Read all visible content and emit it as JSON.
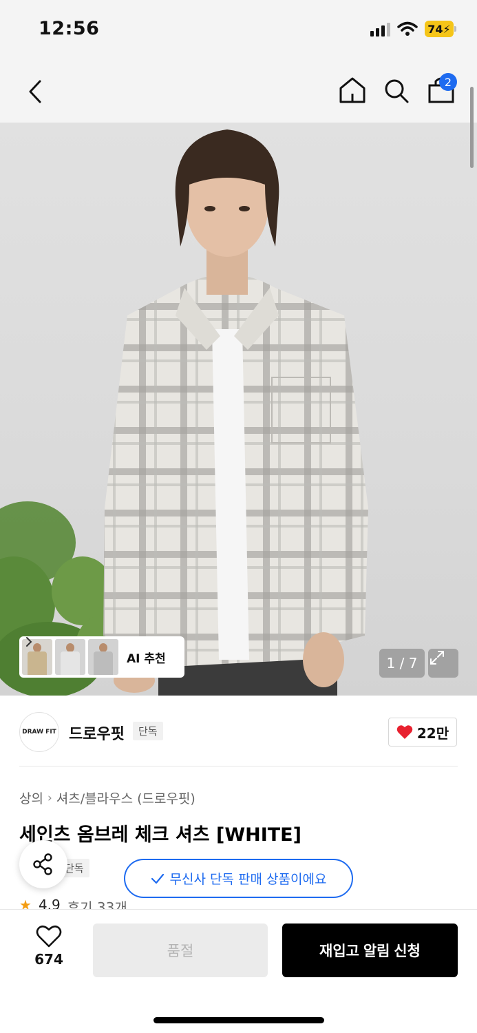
{
  "status": {
    "time": "12:56",
    "battery": "74"
  },
  "nav": {
    "cart_count": "2"
  },
  "gallery": {
    "counter": "1 / 7",
    "ai_label": "AI 추천"
  },
  "brand": {
    "logo_text": "DRAW FIT",
    "name": "드로우핏",
    "tag": "단독",
    "likes": "22만"
  },
  "product": {
    "breadcrumb": [
      "상의",
      "셔츠/블라우스 (드로우핏)"
    ],
    "title": "세인츠 옴브레 체크 셔츠 [WHITE]",
    "exclusive_tag": "단독",
    "exclusive_notice": "무신사 단독 판매 상품이에요",
    "rating": "4.9",
    "reviews": "후기 33개"
  },
  "bottom": {
    "wish_count": "674",
    "soldout_label": "품절",
    "restock_label": "재입고 알림 신청"
  },
  "colors": {
    "accent": "#1e6bf0",
    "heart": "#e8212f",
    "star": "#f39c12"
  }
}
